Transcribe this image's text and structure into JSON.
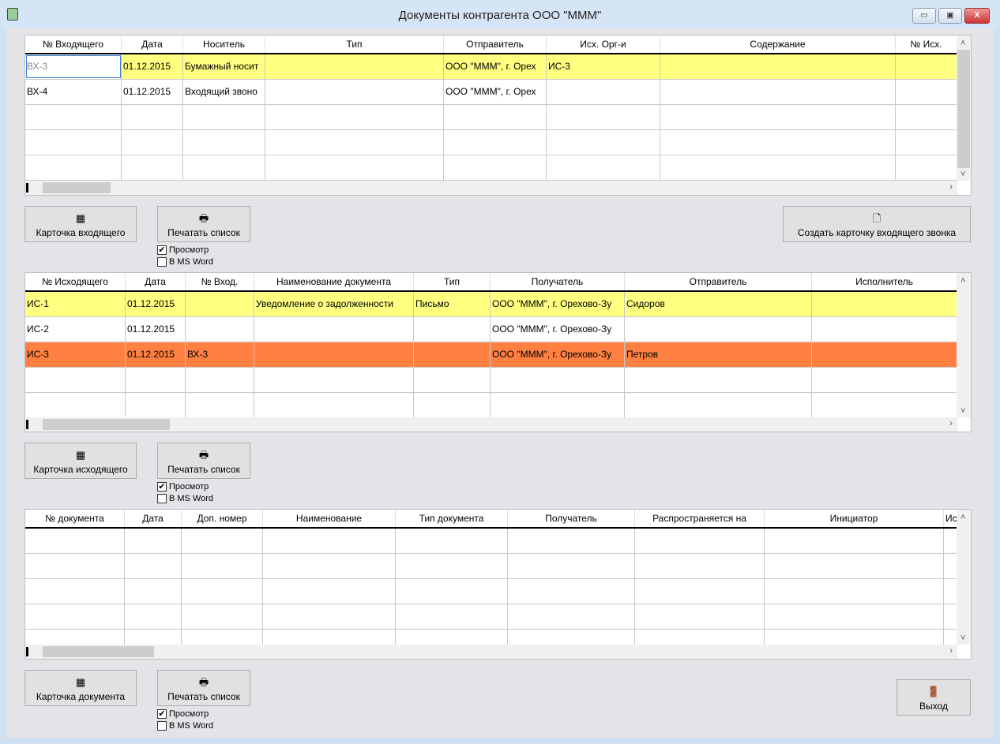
{
  "window": {
    "title": "Документы контрагента ООО \"МММ\"",
    "minimize": "▭",
    "maximize": "▣",
    "close": "X"
  },
  "colors": {
    "yellow": "#ffff80",
    "orange": "#ff8040",
    "selected_border": "#3b7fd8"
  },
  "incoming": {
    "columns": [
      "№ Входящего",
      "Дата",
      "Носитель",
      "Тип",
      "Отправитель",
      "Исх. Орг-и",
      "Содержание",
      "№ Исх."
    ],
    "rows": [
      {
        "cells": [
          "ВХ-3",
          "01.12.2015",
          "Бумажный носит",
          "",
          "ООО \"МММ\", г. Орех",
          "ИС-3",
          "",
          ""
        ],
        "color": "yellow"
      },
      {
        "cells": [
          "ВХ-4",
          "01.12.2015",
          "Входящий звоно",
          "",
          "ООО \"МММ\", г. Орех",
          "",
          "",
          ""
        ],
        "color": "white"
      },
      {
        "cells": [
          "",
          "",
          "",
          "",
          "",
          "",
          "",
          ""
        ],
        "color": "white"
      },
      {
        "cells": [
          "",
          "",
          "",
          "",
          "",
          "",
          "",
          ""
        ],
        "color": "white"
      },
      {
        "cells": [
          "",
          "",
          "",
          "",
          "",
          "",
          "",
          ""
        ],
        "color": "white"
      }
    ],
    "card_button": "Карточка входящего",
    "print_button": "Печатать список",
    "preview": "Просмотр",
    "msword": "В MS Word",
    "preview_checked": true,
    "msword_checked": false,
    "create_call_button": "Создать карточку входящего звонка"
  },
  "outgoing": {
    "columns": [
      "№ Исходящего",
      "Дата",
      "№ Вход.",
      "Наименование документа",
      "Тип",
      "Получатель",
      "Отправитель",
      "Исполнитель"
    ],
    "rows": [
      {
        "cells": [
          "ИС-1",
          "01.12.2015",
          "",
          "Уведомление о задолженности",
          "Письмо",
          "ООО \"МММ\", г. Орехово-Зу",
          "Сидоров",
          ""
        ],
        "color": "yellow"
      },
      {
        "cells": [
          "ИС-2",
          "01.12.2015",
          "",
          "",
          "",
          "ООО \"МММ\", г. Орехово-Зу",
          "",
          ""
        ],
        "color": "white"
      },
      {
        "cells": [
          "ИС-3",
          "01.12.2015",
          "ВХ-3",
          "",
          "",
          "ООО \"МММ\", г. Орехово-Зу",
          "Петров",
          ""
        ],
        "color": "orange"
      },
      {
        "cells": [
          "",
          "",
          "",
          "",
          "",
          "",
          "",
          ""
        ],
        "color": "white"
      },
      {
        "cells": [
          "",
          "",
          "",
          "",
          "",
          "",
          "",
          ""
        ],
        "color": "white"
      }
    ],
    "card_button": "Карточка исходящего",
    "print_button": "Печатать список",
    "preview": "Просмотр",
    "msword": "В MS Word",
    "preview_checked": true,
    "msword_checked": false
  },
  "documents": {
    "columns": [
      "№ документа",
      "Дата",
      "Доп. номер",
      "Наименование",
      "Тип документа",
      "Получатель",
      "Распространяется на",
      "Инициатор",
      "Ис"
    ],
    "rows": [
      {
        "cells": [
          "",
          "",
          "",
          "",
          "",
          "",
          "",
          "",
          ""
        ],
        "color": "white"
      },
      {
        "cells": [
          "",
          "",
          "",
          "",
          "",
          "",
          "",
          "",
          ""
        ],
        "color": "white"
      },
      {
        "cells": [
          "",
          "",
          "",
          "",
          "",
          "",
          "",
          "",
          ""
        ],
        "color": "white"
      },
      {
        "cells": [
          "",
          "",
          "",
          "",
          "",
          "",
          "",
          "",
          ""
        ],
        "color": "white"
      },
      {
        "cells": [
          "",
          "",
          "",
          "",
          "",
          "",
          "",
          "",
          ""
        ],
        "color": "white"
      }
    ],
    "card_button": "Карточка документа",
    "print_button": "Печатать список",
    "preview": "Просмотр",
    "msword": "В MS Word",
    "preview_checked": true,
    "msword_checked": false
  },
  "exit_button": "Выход"
}
